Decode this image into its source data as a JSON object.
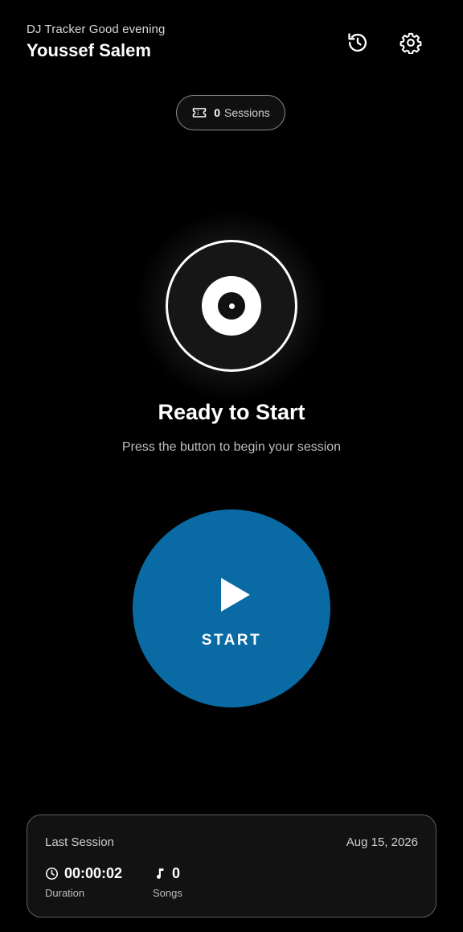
{
  "header": {
    "greeting": "DJ Tracker Good evening",
    "user_name": "Youssef Salem",
    "history_icon": "history-icon",
    "settings_icon": "gear-icon"
  },
  "sessions_pill": {
    "icon": "ticket-icon",
    "count": "0",
    "label": "Sessions"
  },
  "hero": {
    "icon": "vinyl-record-icon",
    "title": "Ready to Start",
    "subtitle": "Press the button to begin your session"
  },
  "start_button": {
    "icon": "play-icon",
    "label": "START",
    "color": "#0a6aa3"
  },
  "last_session": {
    "title": "Last Session",
    "date": "Aug 15, 2026",
    "duration": {
      "icon": "clock-icon",
      "value": "00:00:02",
      "label": "Duration"
    },
    "songs": {
      "icon": "music-note-icon",
      "value": "0",
      "label": "Songs"
    }
  },
  "colors": {
    "background": "#000000",
    "accent": "#0a6aa3",
    "card_background": "#121212"
  }
}
